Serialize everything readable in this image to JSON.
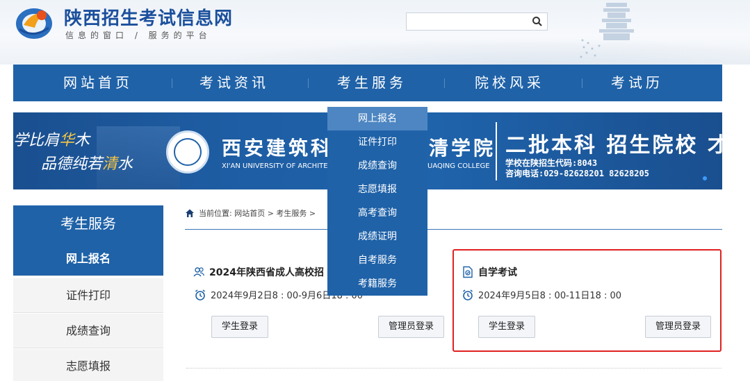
{
  "header": {
    "site_title": "陕西招生考试信息网",
    "slogan": "信息的窗口 / 服务的平台",
    "search_placeholder": ""
  },
  "nav": {
    "items": [
      "网站首页",
      "考试资讯",
      "考生服务",
      "院校风采",
      "考试历"
    ]
  },
  "banner": {
    "motto_line1_a": "学比肩",
    "motto_line1_hl": "华",
    "motto_line1_b": "木",
    "motto_line2_a": "品德纯若",
    "motto_line2_hl": "清",
    "motto_line2_b": "水",
    "university_cn": "西安建筑科",
    "university_en": "XI'AN UNIVERSITY OF ARCHITE",
    "college_cn": "清学院",
    "college_en": "UAQING COLLEGE",
    "headline": "二批本科 招生院校 才",
    "code": "学校在陕招生代码:8043",
    "phone": "咨询电话:029-82628201 82628205"
  },
  "dropdown": {
    "items": [
      "网上报名",
      "证件打印",
      "成绩查询",
      "志愿填报",
      "高考查询",
      "成绩证明",
      "自考服务",
      "考籍服务"
    ]
  },
  "sidebar": {
    "title": "考生服务",
    "items": [
      "网上报名",
      "证件打印",
      "成绩查询",
      "志愿填报"
    ]
  },
  "breadcrumb": {
    "text": "当前位置: 网站首页 > 考生服务 >"
  },
  "cards": [
    {
      "title": "2024年陕西省成人高校招",
      "time": "2024年9月2日8 : 00-9月6日18 : 00",
      "student_login": "学生登录",
      "admin_login": "管理员登录"
    },
    {
      "title": "自学考试",
      "time": "2024年9月5日8 : 00-11日18 : 00",
      "student_login": "学生登录",
      "admin_login": "管理员登录"
    }
  ],
  "colors": {
    "primary": "#1f62a8",
    "active_dropdown": "#4d86c2",
    "highlight": "#e02020",
    "banner_accent": "#f6c644"
  }
}
